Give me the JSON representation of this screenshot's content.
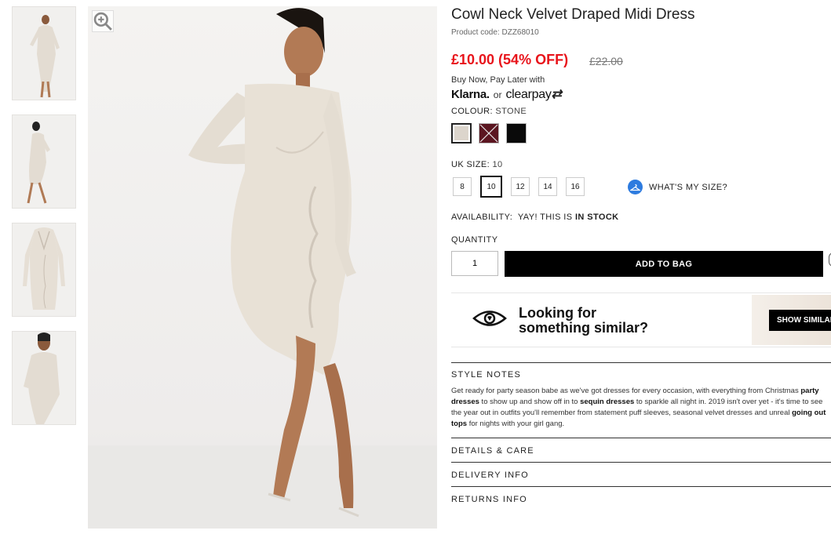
{
  "product": {
    "title": "Cowl Neck Velvet Draped Midi Dress",
    "code": "Product code: DZZ68010",
    "price": "£10.00 (54% OFF)",
    "was_price": "£22.00"
  },
  "payment": {
    "text": "Buy Now, Pay Later with",
    "klarna": "Klarna.",
    "or": "or",
    "clearpay": "clearpay"
  },
  "colour": {
    "label": "COLOUR:",
    "selected": "STONE",
    "swatches": [
      {
        "name": "Stone",
        "color": "#dcd5cc"
      },
      {
        "name": "Wine",
        "color": "#5b1520"
      },
      {
        "name": "Black",
        "color": "#0a0a0a"
      }
    ]
  },
  "size": {
    "label": "UK SIZE:",
    "selected": "10",
    "options": [
      "8",
      "10",
      "12",
      "14",
      "16"
    ],
    "whats_my_size": "WHAT'S MY SIZE?"
  },
  "availability": {
    "label": "AVAILABILITY:",
    "text": "YAY! THIS IS",
    "status": "IN STOCK"
  },
  "quantity": {
    "label": "QUANTITY",
    "value": "1"
  },
  "add_to_bag": "ADD TO BAG",
  "similar": {
    "line1": "Looking for",
    "line2": "something similar?",
    "button": "SHOW SIMILAR"
  },
  "sections": {
    "style_notes": "STYLE NOTES",
    "details": "DETAILS & CARE",
    "delivery": "DELIVERY INFO",
    "returns": "RETURNS INFO"
  },
  "style_notes": {
    "p1": "Get ready for party season babe as we've got dresses for every occasion, with everything from Christmas ",
    "l1": "party dresses",
    "p2": " to show up and show off in to ",
    "l2": "sequin dresses",
    "p3": " to sparkle all night in. 2019 isn't over yet - it's time to see the year out in outfits you'll remember from statement puff sleeves, seasonal velvet dresses and unreal ",
    "l3": "going out tops",
    "p4": " for nights with your girl gang."
  }
}
